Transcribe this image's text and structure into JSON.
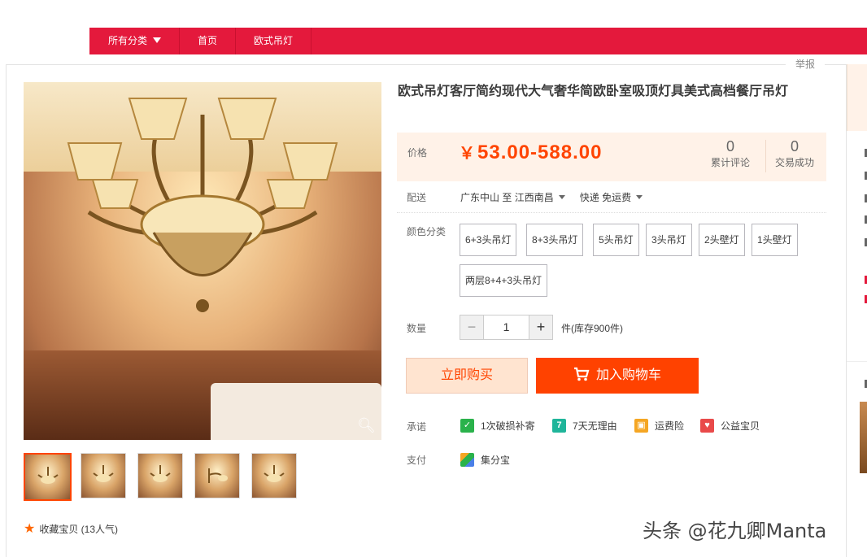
{
  "nav": {
    "all_categories": "所有分类",
    "home": "首页",
    "category": "欧式吊灯"
  },
  "report": "举报",
  "product": {
    "title": "欧式吊灯客厅简约现代大气奢华简欧卧室吸顶灯具美式高档餐厅吊灯",
    "price_label": "价格",
    "currency": "￥",
    "price": "53.00-588.00",
    "reviews_count": "0",
    "reviews_label": "累计评论",
    "deals_count": "0",
    "deals_label": "交易成功"
  },
  "shipping": {
    "label": "配送",
    "from": "广东中山",
    "to_word": "至",
    "to": "江西南昌",
    "method": "快递 免运费"
  },
  "color": {
    "label": "颜色分类",
    "options": [
      "6+3头吊灯",
      "8+3头吊灯",
      "5头吊灯",
      "3头吊灯",
      "2头壁灯",
      "1头壁灯",
      "两层8+4+3头吊灯"
    ]
  },
  "quantity": {
    "label": "数量",
    "value": "1",
    "minus": "−",
    "plus": "+",
    "stock_text": "件(库存900件)"
  },
  "actions": {
    "buy_now": "立即购买",
    "add_to_cart": "加入购物车"
  },
  "promise": {
    "label": "承诺",
    "items": [
      "1次破损补寄",
      "7天无理由",
      "运费险",
      "公益宝贝"
    ]
  },
  "payment": {
    "label": "支付",
    "method": "集分宝"
  },
  "favorite": {
    "text": "收藏宝贝 (13人气)"
  },
  "watermark": "头条 @花九卿Manta",
  "colors": {
    "brand_red": "#e4193c",
    "price_orange": "#ff4400",
    "cart_button": "#ff4200"
  }
}
